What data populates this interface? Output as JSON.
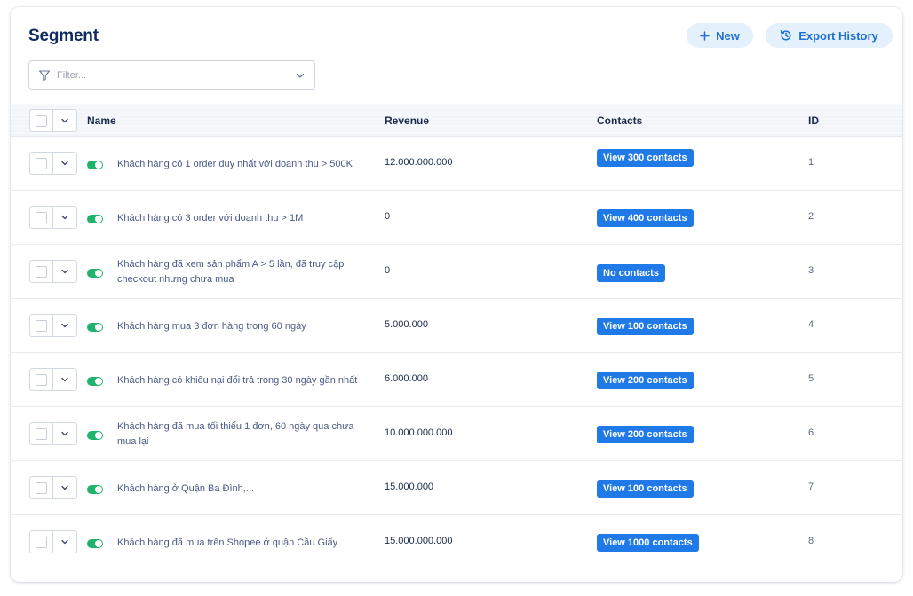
{
  "page_title": "Segment",
  "header_actions": {
    "new_label": "New",
    "export_label": "Export History"
  },
  "filter": {
    "placeholder": "Filter..."
  },
  "table": {
    "columns": {
      "name": "Name",
      "revenue": "Revenue",
      "contacts": "Contacts",
      "id": "ID"
    },
    "rows": [
      {
        "name": "Khách hàng có 1 order duy nhất với doanh thu > 500K",
        "revenue": "12.000.000.000",
        "contacts": "View 300 contacts",
        "id": "1",
        "enabled": true
      },
      {
        "name": "Khách hàng có 3 order với doanh thu > 1M",
        "revenue": "0",
        "contacts": "View 400 contacts",
        "id": "2",
        "enabled": true
      },
      {
        "name": "Khách hàng đã xem sản phẩm A > 5 lần, đã truy cập checkout nhưng chưa mua",
        "revenue": "0",
        "contacts": "No contacts",
        "id": "3",
        "enabled": true
      },
      {
        "name": "Khách hàng mua 3 đơn hàng trong 60 ngày",
        "revenue": "5.000.000",
        "contacts": "View 100 contacts",
        "id": "4",
        "enabled": true
      },
      {
        "name": "Khách hàng có khiếu nại đổi trả trong 30 ngày gần nhất",
        "revenue": "6.000.000",
        "contacts": "View 200 contacts",
        "id": "5",
        "enabled": true
      },
      {
        "name": "Khách hàng đã mua tối thiểu 1 đơn, 60 ngày qua chưa mua lại",
        "revenue": "10.000.000.000",
        "contacts": "View 200 contacts",
        "id": "6",
        "enabled": true
      },
      {
        "name": "Khách hàng ở Quận Ba Đình,...",
        "revenue": "15.000.000",
        "contacts": "View 100 contacts",
        "id": "7",
        "enabled": true
      },
      {
        "name": "Khách hàng đã mua trên Shopee ở quận Cầu Giấy",
        "revenue": "15.000.000.000",
        "contacts": "View 1000 contacts",
        "id": "8",
        "enabled": true
      }
    ]
  },
  "colors": {
    "accent": "#1f7ae8",
    "toggle_on": "#1fb36b",
    "title": "#0f2a5c",
    "pill_bg": "#e4f1fd"
  },
  "icons": {
    "new": "plus-icon",
    "export": "history-icon",
    "filter": "funnel-icon",
    "dropdown": "chevron-down-icon"
  }
}
